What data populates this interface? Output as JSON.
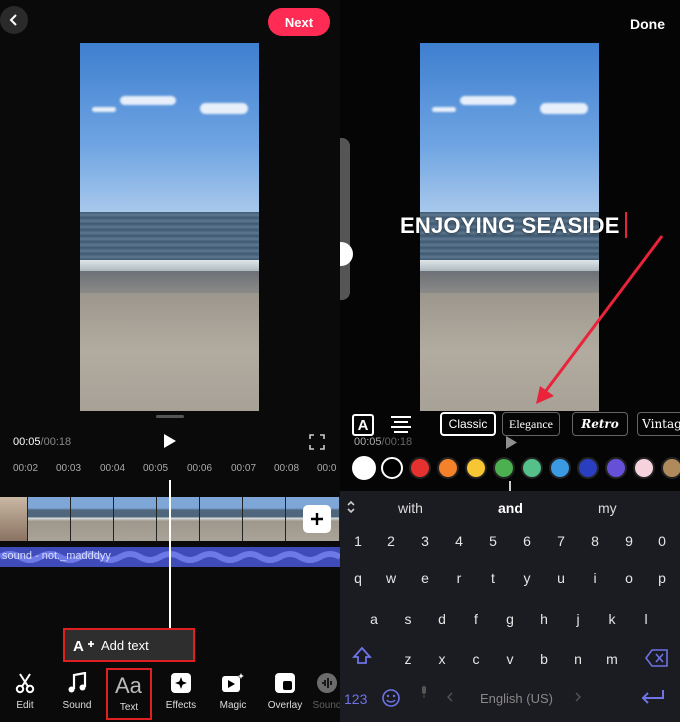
{
  "left": {
    "next_label": "Next",
    "time_current": "00:05",
    "time_sep_total": "/00:18",
    "ruler_ticks": [
      "00:02",
      "00:03",
      "00:04",
      "00:05",
      "00:06",
      "00:07",
      "00:08",
      "00:0"
    ],
    "sound_label": "sound - not._madddyy",
    "add_text_label": "Add text",
    "tools": [
      {
        "label": "Edit",
        "icon": "scissors-icon"
      },
      {
        "label": "Sound",
        "icon": "music-note-icon"
      },
      {
        "label": "Text",
        "icon": "text-aa-icon"
      },
      {
        "label": "Effects",
        "icon": "effects-icon"
      },
      {
        "label": "Magic",
        "icon": "magic-icon"
      },
      {
        "label": "Overlay",
        "icon": "overlay-icon"
      },
      {
        "label": "Sound",
        "icon": "sound-icon"
      }
    ]
  },
  "right": {
    "done_label": "Done",
    "overlay_text": "ENJOYING SEASIDE",
    "time_current": "00:05",
    "time_sep_total": "/00:18",
    "font_styles": [
      "Classic",
      "Elegance",
      "Retro",
      "Vintag"
    ],
    "selected_font": "Classic",
    "colors": [
      "#ffffff",
      "#000000",
      "#e5312f",
      "#f4822a",
      "#f6c633",
      "#4caf50",
      "#55c08a",
      "#3a9be3",
      "#2a3ec0",
      "#6750d8",
      "#f6d3dc",
      "#b08a5a"
    ],
    "suggestions": [
      "with",
      "and",
      "my"
    ],
    "number_row": [
      "1",
      "2",
      "3",
      "4",
      "5",
      "6",
      "7",
      "8",
      "9",
      "0"
    ],
    "row_q": [
      "q",
      "w",
      "e",
      "r",
      "t",
      "y",
      "u",
      "i",
      "o",
      "p"
    ],
    "row_a": [
      "a",
      "s",
      "d",
      "f",
      "g",
      "h",
      "j",
      "k",
      "l"
    ],
    "row_z": [
      "z",
      "x",
      "c",
      "v",
      "b",
      "n",
      "m"
    ],
    "numbers_key": "123",
    "space_label": "English (US)"
  },
  "colors": {
    "accent": "#fe2c55",
    "highlight": "#e02020",
    "sound_track": "#3f4bb8"
  }
}
